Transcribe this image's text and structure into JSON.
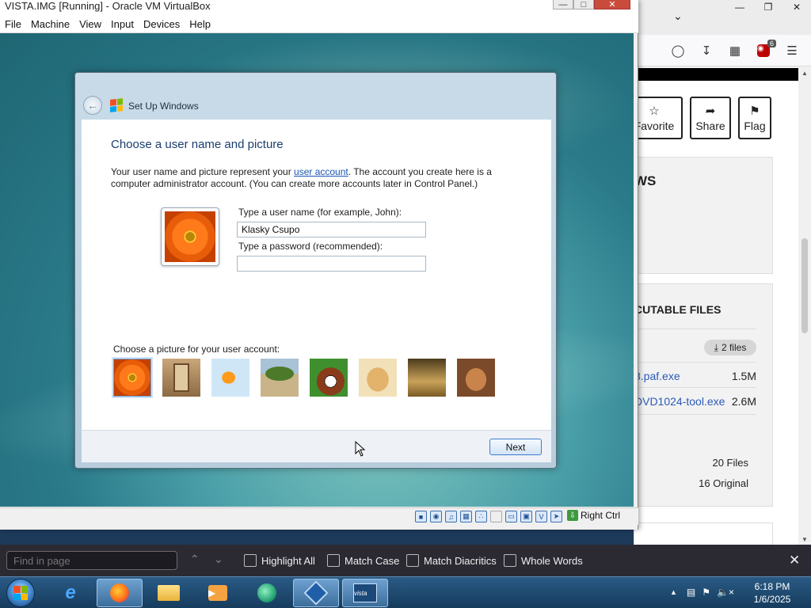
{
  "vbox": {
    "title": "VISTA.IMG [Running] - Oracle VM VirtualBox",
    "menu": [
      "File",
      "Machine",
      "View",
      "Input",
      "Devices",
      "Help"
    ],
    "statusbar_host_key": "Right Ctrl"
  },
  "setup": {
    "window_title": "Set Up Windows",
    "heading": "Choose a user name and picture",
    "description_pre": "Your user name and picture represent your ",
    "description_link": "user account",
    "description_post": ". The account you create here is a computer administrator account. (You can create more accounts later in Control Panel.)",
    "username_label": "Type a user name (for example, John):",
    "username_value": "Klasky Csupo",
    "password_label": "Type a password (recommended):",
    "password_value": "",
    "pictures_label": "Choose a picture for your user account:",
    "pictures": [
      "flower-icon",
      "robot-icon",
      "goldfish-icon",
      "bonsai-icon",
      "soccer-dog-icon",
      "puppy-icon",
      "chess-icon",
      "kitten-icon"
    ],
    "selected_picture": 0,
    "next_label": "Next"
  },
  "browser": {
    "ext_badge": "6",
    "actions": [
      "Favorite",
      "Share",
      "Flag"
    ],
    "card1_big": "WS",
    "card1_small": ":",
    "card2_header": "CUTABLE FILES",
    "files_pill": "2 files",
    "files": [
      {
        "name": "8.paf.exe",
        "size": "1.5M"
      },
      {
        "name": "DVD1024-tool.exe",
        "size": "2.6M"
      }
    ],
    "stats": [
      "20 Files",
      "16 Original"
    ]
  },
  "findbar": {
    "placeholder": "Find in page",
    "options": [
      "Highlight All",
      "Match Case",
      "Match Diacritics",
      "Whole Words"
    ]
  },
  "taskbar": {
    "time": "6:18 PM",
    "date": "1/6/2025"
  }
}
